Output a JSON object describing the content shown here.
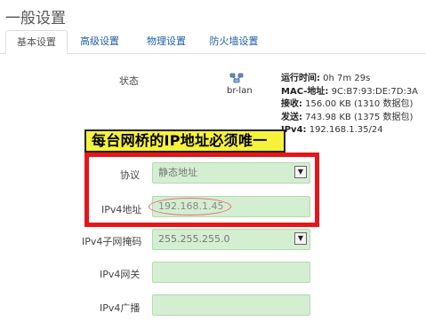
{
  "page": {
    "title": "一般设置"
  },
  "tabs": [
    {
      "label": "基本设置",
      "active": true
    },
    {
      "label": "高级设置",
      "active": false
    },
    {
      "label": "物理设置",
      "active": false
    },
    {
      "label": "防火墙设置",
      "active": false
    }
  ],
  "status": {
    "label": "状态",
    "interface": "br-lan",
    "rows": [
      {
        "key": "运行时间:",
        "value": " 0h 7m 29s"
      },
      {
        "key": "MAC-地址:",
        "value": " 9C:B7:93:DE:7D:3A"
      },
      {
        "key": "接收:",
        "value": " 156.00 KB (1310 数据包)"
      },
      {
        "key": "发送:",
        "value": " 743.98 KB (1375 数据包)"
      },
      {
        "key": "IPv4:",
        "value": " 192.168.1.35/24"
      }
    ]
  },
  "annotation": {
    "banner_text": "每台网桥的IP地址必须唯一",
    "highlight_color": "#e8141b"
  },
  "form": {
    "protocol": {
      "label": "协议",
      "value": "静态地址"
    },
    "ipv4_address": {
      "label": "IPv4地址",
      "value": "192.168.1.45"
    },
    "ipv4_netmask": {
      "label": "IPv4子网掩码",
      "value": "255.255.255.0"
    },
    "ipv4_gateway": {
      "label": "IPv4网关",
      "value": ""
    },
    "ipv4_broadcast": {
      "label": "IPv4广播",
      "value": ""
    }
  },
  "colors": {
    "field_bg": "#d4eed1",
    "banner_bg": "#f6f23a",
    "link": "#1f5fa8"
  }
}
